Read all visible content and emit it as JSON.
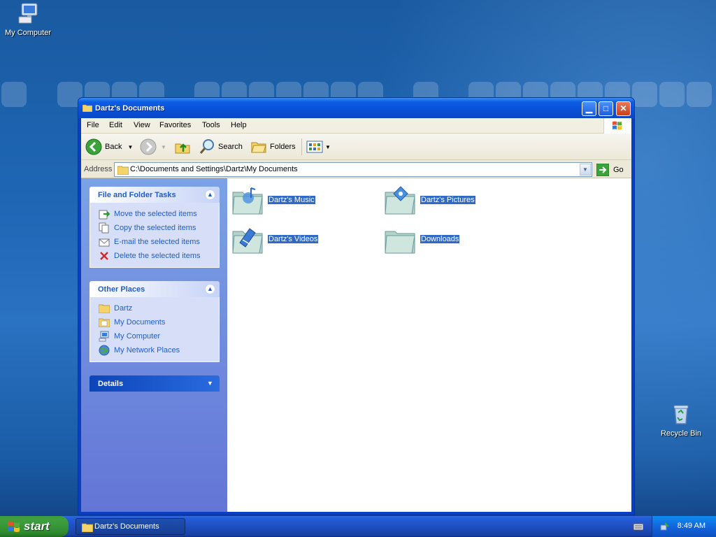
{
  "desktop": {
    "icons": [
      {
        "label": "My Computer"
      },
      {
        "label": "Recycle Bin"
      }
    ]
  },
  "window": {
    "title": "Dartz's Documents",
    "menu": [
      "File",
      "Edit",
      "View",
      "Favorites",
      "Tools",
      "Help"
    ],
    "toolbar": {
      "back_label": "Back",
      "search_label": "Search",
      "folders_label": "Folders"
    },
    "address": {
      "label": "Address",
      "value": "C:\\Documents and Settings\\Dartz\\My Documents",
      "go_label": "Go"
    },
    "taskpane": {
      "file_tasks": {
        "title": "File and Folder Tasks",
        "items": [
          {
            "label": "Move the selected items",
            "icon": "move-icon"
          },
          {
            "label": "Copy the selected items",
            "icon": "copy-icon"
          },
          {
            "label": "E-mail the selected items",
            "icon": "email-icon"
          },
          {
            "label": "Delete the selected items",
            "icon": "delete-icon"
          }
        ]
      },
      "other_places": {
        "title": "Other Places",
        "items": [
          {
            "label": "Dartz",
            "icon": "folder-icon"
          },
          {
            "label": "My Documents",
            "icon": "my-documents-icon"
          },
          {
            "label": "My Computer",
            "icon": "computer-icon"
          },
          {
            "label": "My Network Places",
            "icon": "network-icon"
          }
        ]
      },
      "details": {
        "title": "Details"
      }
    },
    "folders": [
      {
        "name": "Dartz's Music",
        "icon": "music-folder-icon"
      },
      {
        "name": "Dartz's Pictures",
        "icon": "pictures-folder-icon"
      },
      {
        "name": "Dartz's Videos",
        "icon": "videos-folder-icon"
      },
      {
        "name": "Downloads",
        "icon": "folder-icon"
      }
    ]
  },
  "taskbar": {
    "start_label": "start",
    "task_item": "Dartz's Documents",
    "clock": "8:49 AM"
  },
  "colors": {
    "titlebar": "#0a48c4",
    "selection": "#316ac5",
    "taskpane_link": "#215dc6",
    "start_green": "#3f9f3f"
  }
}
